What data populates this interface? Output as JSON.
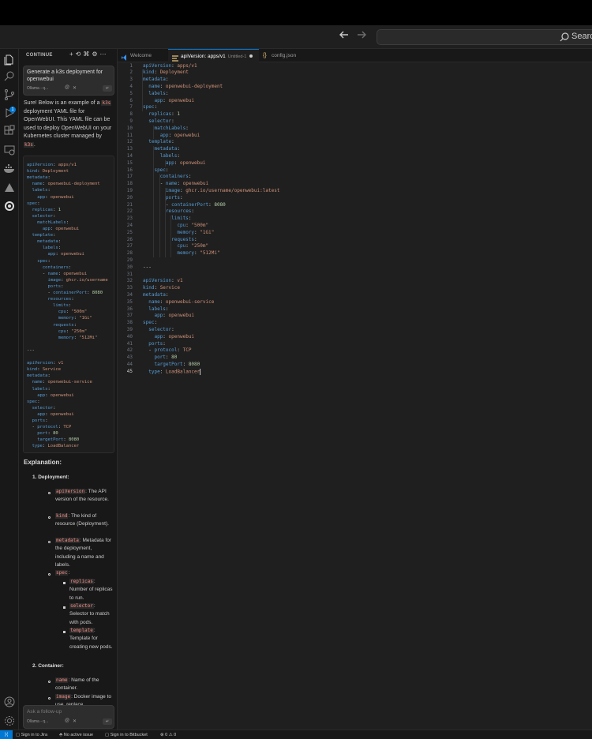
{
  "titlebar": {
    "back_icon": "arrow-left-icon",
    "forward_icon": "arrow-right-icon",
    "search_label": "Search"
  },
  "activity_bar": {
    "explorer_badge": "1",
    "icons": [
      "files-icon",
      "search-icon",
      "source-control-icon",
      "run-debug-icon",
      "extensions-icon",
      "remote-explorer-icon",
      "docker-icon",
      "ai-triangle-icon",
      "continue-icon",
      "account-icon",
      "settings-gear-icon"
    ]
  },
  "side_panel": {
    "title": "CONTINUE",
    "prompt": "Generate a k3s deployment for openwebui",
    "model_label": "Ollama - q...",
    "intro_before": "Sure! Below is an example of a ",
    "intro_code1": "k3s",
    "intro_middle": " deployment YAML file for OpenWebUI. This YAML file can be used to deploy OpenWebUI on your Kubernetes cluster managed by ",
    "intro_code2": "k3s",
    "intro_end": ".",
    "code_lines": [
      "apiVersion: apps/v1",
      "kind: Deployment",
      "metadata:",
      "  name: openwebui-deployment",
      "  labels:",
      "    app: openwebui",
      "spec:",
      "  replicas: 1",
      "  selector:",
      "    matchLabels:",
      "      app: openwebui",
      "  template:",
      "    metadata:",
      "      labels:",
      "        app: openwebui",
      "    spec:",
      "      containers:",
      "      - name: openwebui",
      "        image: ghcr.io/username",
      "        ports:",
      "        - containerPort: 8080",
      "        resources:",
      "          limits:",
      "            cpu: \"500m\"",
      "            memory: \"1Gi\"",
      "          requests:",
      "            cpu: \"250m\"",
      "            memory: \"512Mi\"",
      "",
      "---",
      "",
      "apiVersion: v1",
      "kind: Service",
      "metadata:",
      "  name: openwebui-service",
      "  labels:",
      "    app: openwebui",
      "spec:",
      "  selector:",
      "    app: openwebui",
      "  ports:",
      "  - protocol: TCP",
      "    port: 80",
      "    targetPort: 8080",
      "  type: LoadBalancer"
    ],
    "explanation_title": "Explanation:",
    "section1_title": "Deployment",
    "apiVersion_code": "apiVersion",
    "apiVersion_desc": ": The API version of the resource.",
    "kind_code": "kind",
    "kind_desc": ": The kind of resource (Deployment).",
    "metadata_code": "metadata",
    "metadata_desc": ": Metadata for the deployment, including a name and labels.",
    "spec_code": "spec",
    "spec_suffix": ":",
    "replicas_code": "replicas",
    "replicas_desc": ": Number of replicas to run.",
    "selector_code": "selector",
    "selector_desc": ": Selector to match with pods.",
    "template_code": "template",
    "template_desc": ": Template for creating new pods.",
    "section2_title": "Container",
    "name_code": "name",
    "name_desc": ": Name of the container.",
    "image_code": "image",
    "image_desc": ": Docker image to use, replace",
    "followup_placeholder": "Ask a follow-up",
    "followup_model": "Ollama - q..."
  },
  "tabs": [
    {
      "label": "Welcome",
      "icon": "vscode-logo-icon"
    },
    {
      "label": "apiVersion: apps/v1",
      "sub": "Untitled-1",
      "icon": "yaml-file-icon"
    },
    {
      "label": "config.json",
      "icon": "json-braces-icon"
    }
  ],
  "editor": {
    "active_line": 45,
    "lines": [
      "apiVersion: apps/v1",
      "kind: Deployment",
      "metadata:",
      "  name: openwebui-deployment",
      "  labels:",
      "    app: openwebui",
      "spec:",
      "  replicas: 1",
      "  selector:",
      "    matchLabels:",
      "      app: openwebui",
      "  template:",
      "    metadata:",
      "      labels:",
      "        app: openwebui",
      "    spec:",
      "      containers:",
      "      - name: openwebui",
      "        image: ghcr.io/username/openwebui:latest",
      "        ports:",
      "        - containerPort: 8080",
      "        resources:",
      "          limits:",
      "            cpu: \"500m\"",
      "            memory: \"1Gi\"",
      "          requests:",
      "            cpu: \"250m\"",
      "            memory: \"512Mi\"",
      "",
      "---",
      "",
      "apiVersion: v1",
      "kind: Service",
      "metadata:",
      "  name: openwebui-service",
      "  labels:",
      "    app: openwebui",
      "spec:",
      "  selector:",
      "    app: openwebui",
      "  ports:",
      "  - protocol: TCP",
      "    port: 80",
      "    targetPort: 8080",
      "  type: LoadBalancer"
    ]
  },
  "statusbar": {
    "remote_icon": "remote-icon",
    "jira": "Sign in to Jira",
    "issue": "No active issue",
    "bitbucket": "Sign in to Bitbucket",
    "problems": "0 ⚠ 0"
  },
  "colors": {
    "accent": "#0078d4",
    "yaml_key": "#569cd6",
    "yaml_string": "#ce9178",
    "yaml_number": "#b5cea8",
    "inline_code": "#f28b82"
  }
}
